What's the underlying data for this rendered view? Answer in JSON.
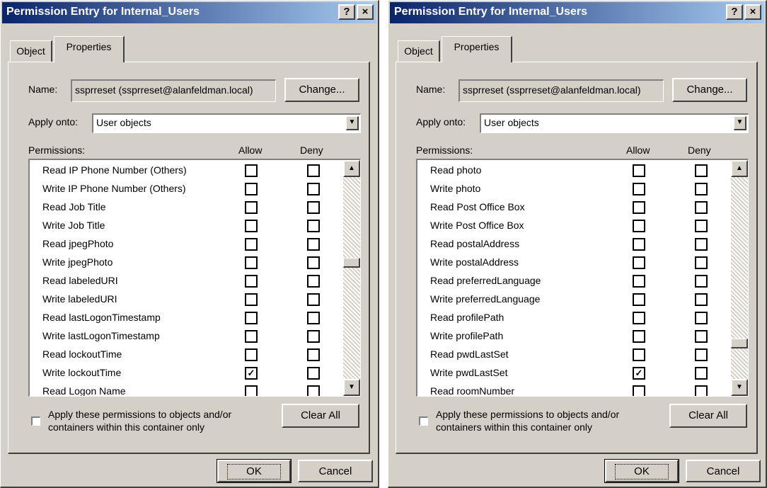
{
  "dialogs": [
    {
      "title": "Permission Entry for Internal_Users",
      "help_button": "?",
      "close_button": "×",
      "tabs": [
        "Object",
        "Properties"
      ],
      "name_label": "Name:",
      "name_value": "ssprreset (ssprreset@alanfeldman.local)",
      "change_button": "Change...",
      "apply_onto_label": "Apply onto:",
      "apply_onto_value": "User objects",
      "permissions_label": "Permissions:",
      "allow_header": "Allow",
      "deny_header": "Deny",
      "permissions": [
        {
          "name": "Read IP Phone Number (Others)",
          "allow": false,
          "deny": false
        },
        {
          "name": "Write IP Phone Number (Others)",
          "allow": false,
          "deny": false
        },
        {
          "name": "Read Job Title",
          "allow": false,
          "deny": false
        },
        {
          "name": "Write Job Title",
          "allow": false,
          "deny": false
        },
        {
          "name": "Read jpegPhoto",
          "allow": false,
          "deny": false
        },
        {
          "name": "Write jpegPhoto",
          "allow": false,
          "deny": false
        },
        {
          "name": "Read labeledURI",
          "allow": false,
          "deny": false
        },
        {
          "name": "Write labeledURI",
          "allow": false,
          "deny": false
        },
        {
          "name": "Read lastLogonTimestamp",
          "allow": false,
          "deny": false
        },
        {
          "name": "Write lastLogonTimestamp",
          "allow": false,
          "deny": false
        },
        {
          "name": "Read lockoutTime",
          "allow": false,
          "deny": false
        },
        {
          "name": "Write lockoutTime",
          "allow": true,
          "deny": false
        },
        {
          "name": "Read Logon Name",
          "allow": false,
          "deny": false
        }
      ],
      "scroll_position_fraction": 0.42,
      "apply_checkbox_checked": false,
      "apply_text_line1": "Apply these permissions to objects and/or",
      "apply_text_line2": "containers within this container only",
      "clear_all_button": "Clear All",
      "ok_button": "OK",
      "cancel_button": "Cancel"
    },
    {
      "title": "Permission Entry for Internal_Users",
      "help_button": "?",
      "close_button": "×",
      "tabs": [
        "Object",
        "Properties"
      ],
      "name_label": "Name:",
      "name_value": "ssprreset (ssprreset@alanfeldman.local)",
      "change_button": "Change...",
      "apply_onto_label": "Apply onto:",
      "apply_onto_value": "User objects",
      "permissions_label": "Permissions:",
      "allow_header": "Allow",
      "deny_header": "Deny",
      "permissions": [
        {
          "name": "Read photo",
          "allow": false,
          "deny": false
        },
        {
          "name": "Write photo",
          "allow": false,
          "deny": false
        },
        {
          "name": "Read Post Office Box",
          "allow": false,
          "deny": false
        },
        {
          "name": "Write Post Office Box",
          "allow": false,
          "deny": false
        },
        {
          "name": "Read postalAddress",
          "allow": false,
          "deny": false
        },
        {
          "name": "Write postalAddress",
          "allow": false,
          "deny": false
        },
        {
          "name": "Read preferredLanguage",
          "allow": false,
          "deny": false
        },
        {
          "name": "Write preferredLanguage",
          "allow": false,
          "deny": false
        },
        {
          "name": "Read profilePath",
          "allow": false,
          "deny": false
        },
        {
          "name": "Write profilePath",
          "allow": false,
          "deny": false
        },
        {
          "name": "Read pwdLastSet",
          "allow": false,
          "deny": false
        },
        {
          "name": "Write pwdLastSet",
          "allow": true,
          "deny": false
        },
        {
          "name": "Read roomNumber",
          "allow": false,
          "deny": false
        }
      ],
      "scroll_position_fraction": 0.84,
      "apply_checkbox_checked": false,
      "apply_text_line1": "Apply these permissions to objects and/or",
      "apply_text_line2": "containers within this container only",
      "clear_all_button": "Clear All",
      "ok_button": "OK",
      "cancel_button": "Cancel"
    }
  ]
}
